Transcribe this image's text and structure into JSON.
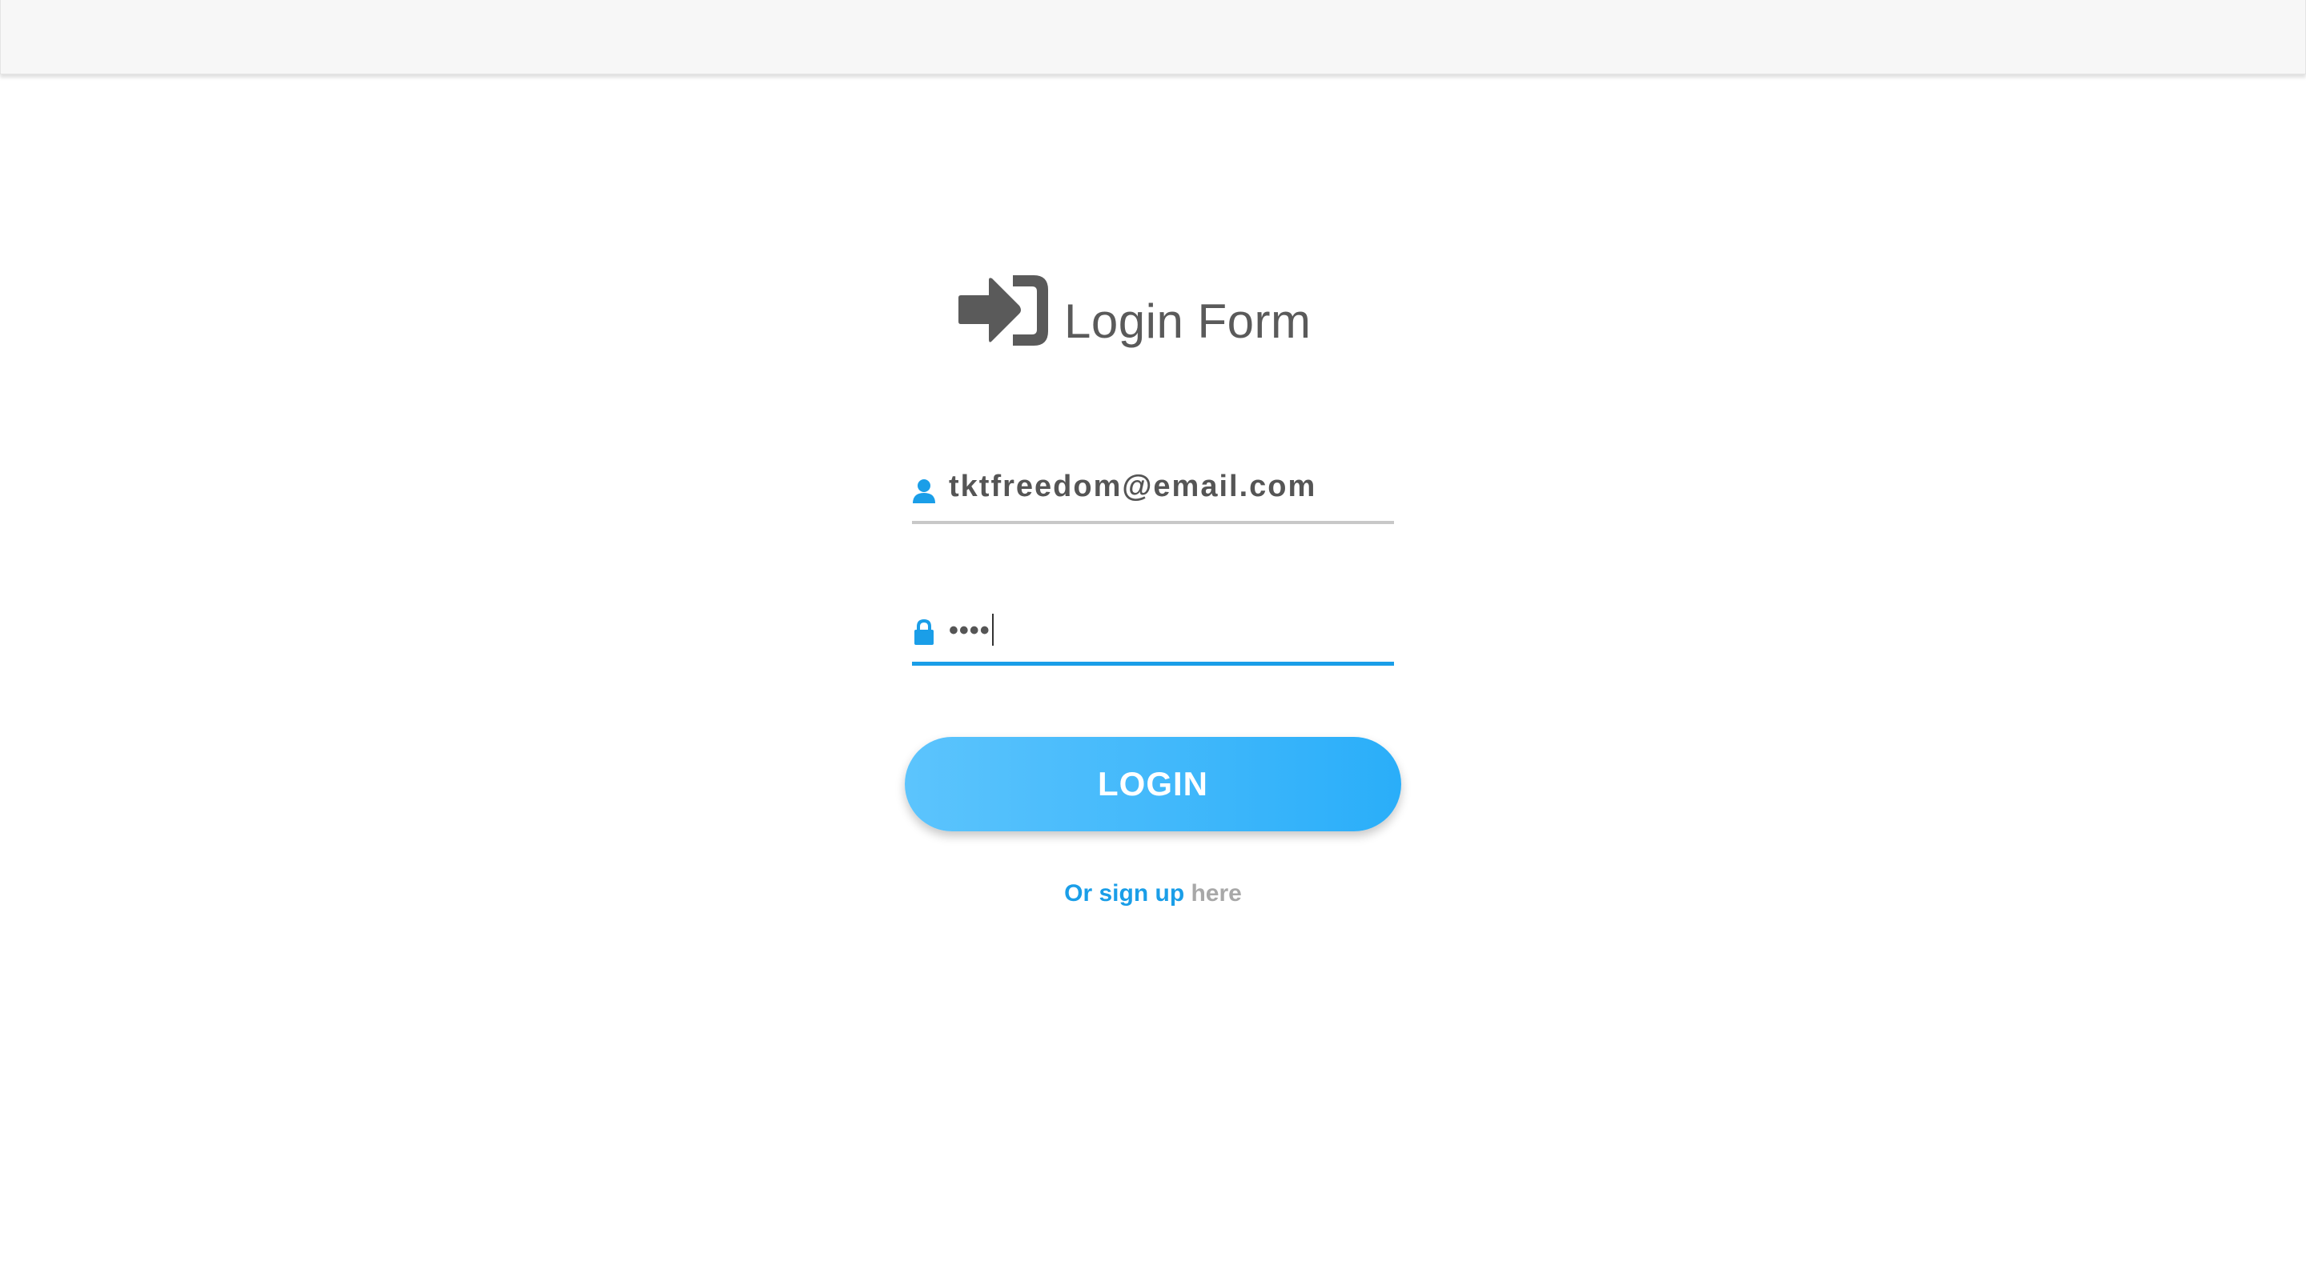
{
  "header": {
    "icon": "sign-in-icon",
    "title": "Login Form"
  },
  "form": {
    "email": {
      "icon": "user-icon",
      "value": "tktfreedom@email.com"
    },
    "password": {
      "icon": "lock-icon",
      "masked_value": "••••"
    },
    "login_label": "LOGIN",
    "signup_link": "Or sign up",
    "signup_suffix": "here"
  },
  "colors": {
    "accent": "#1a9ee8",
    "button_gradient_start": "#5cc4fd",
    "button_gradient_end": "#2aaef9",
    "text": "#555555",
    "topbar": "#f7f7f7"
  }
}
